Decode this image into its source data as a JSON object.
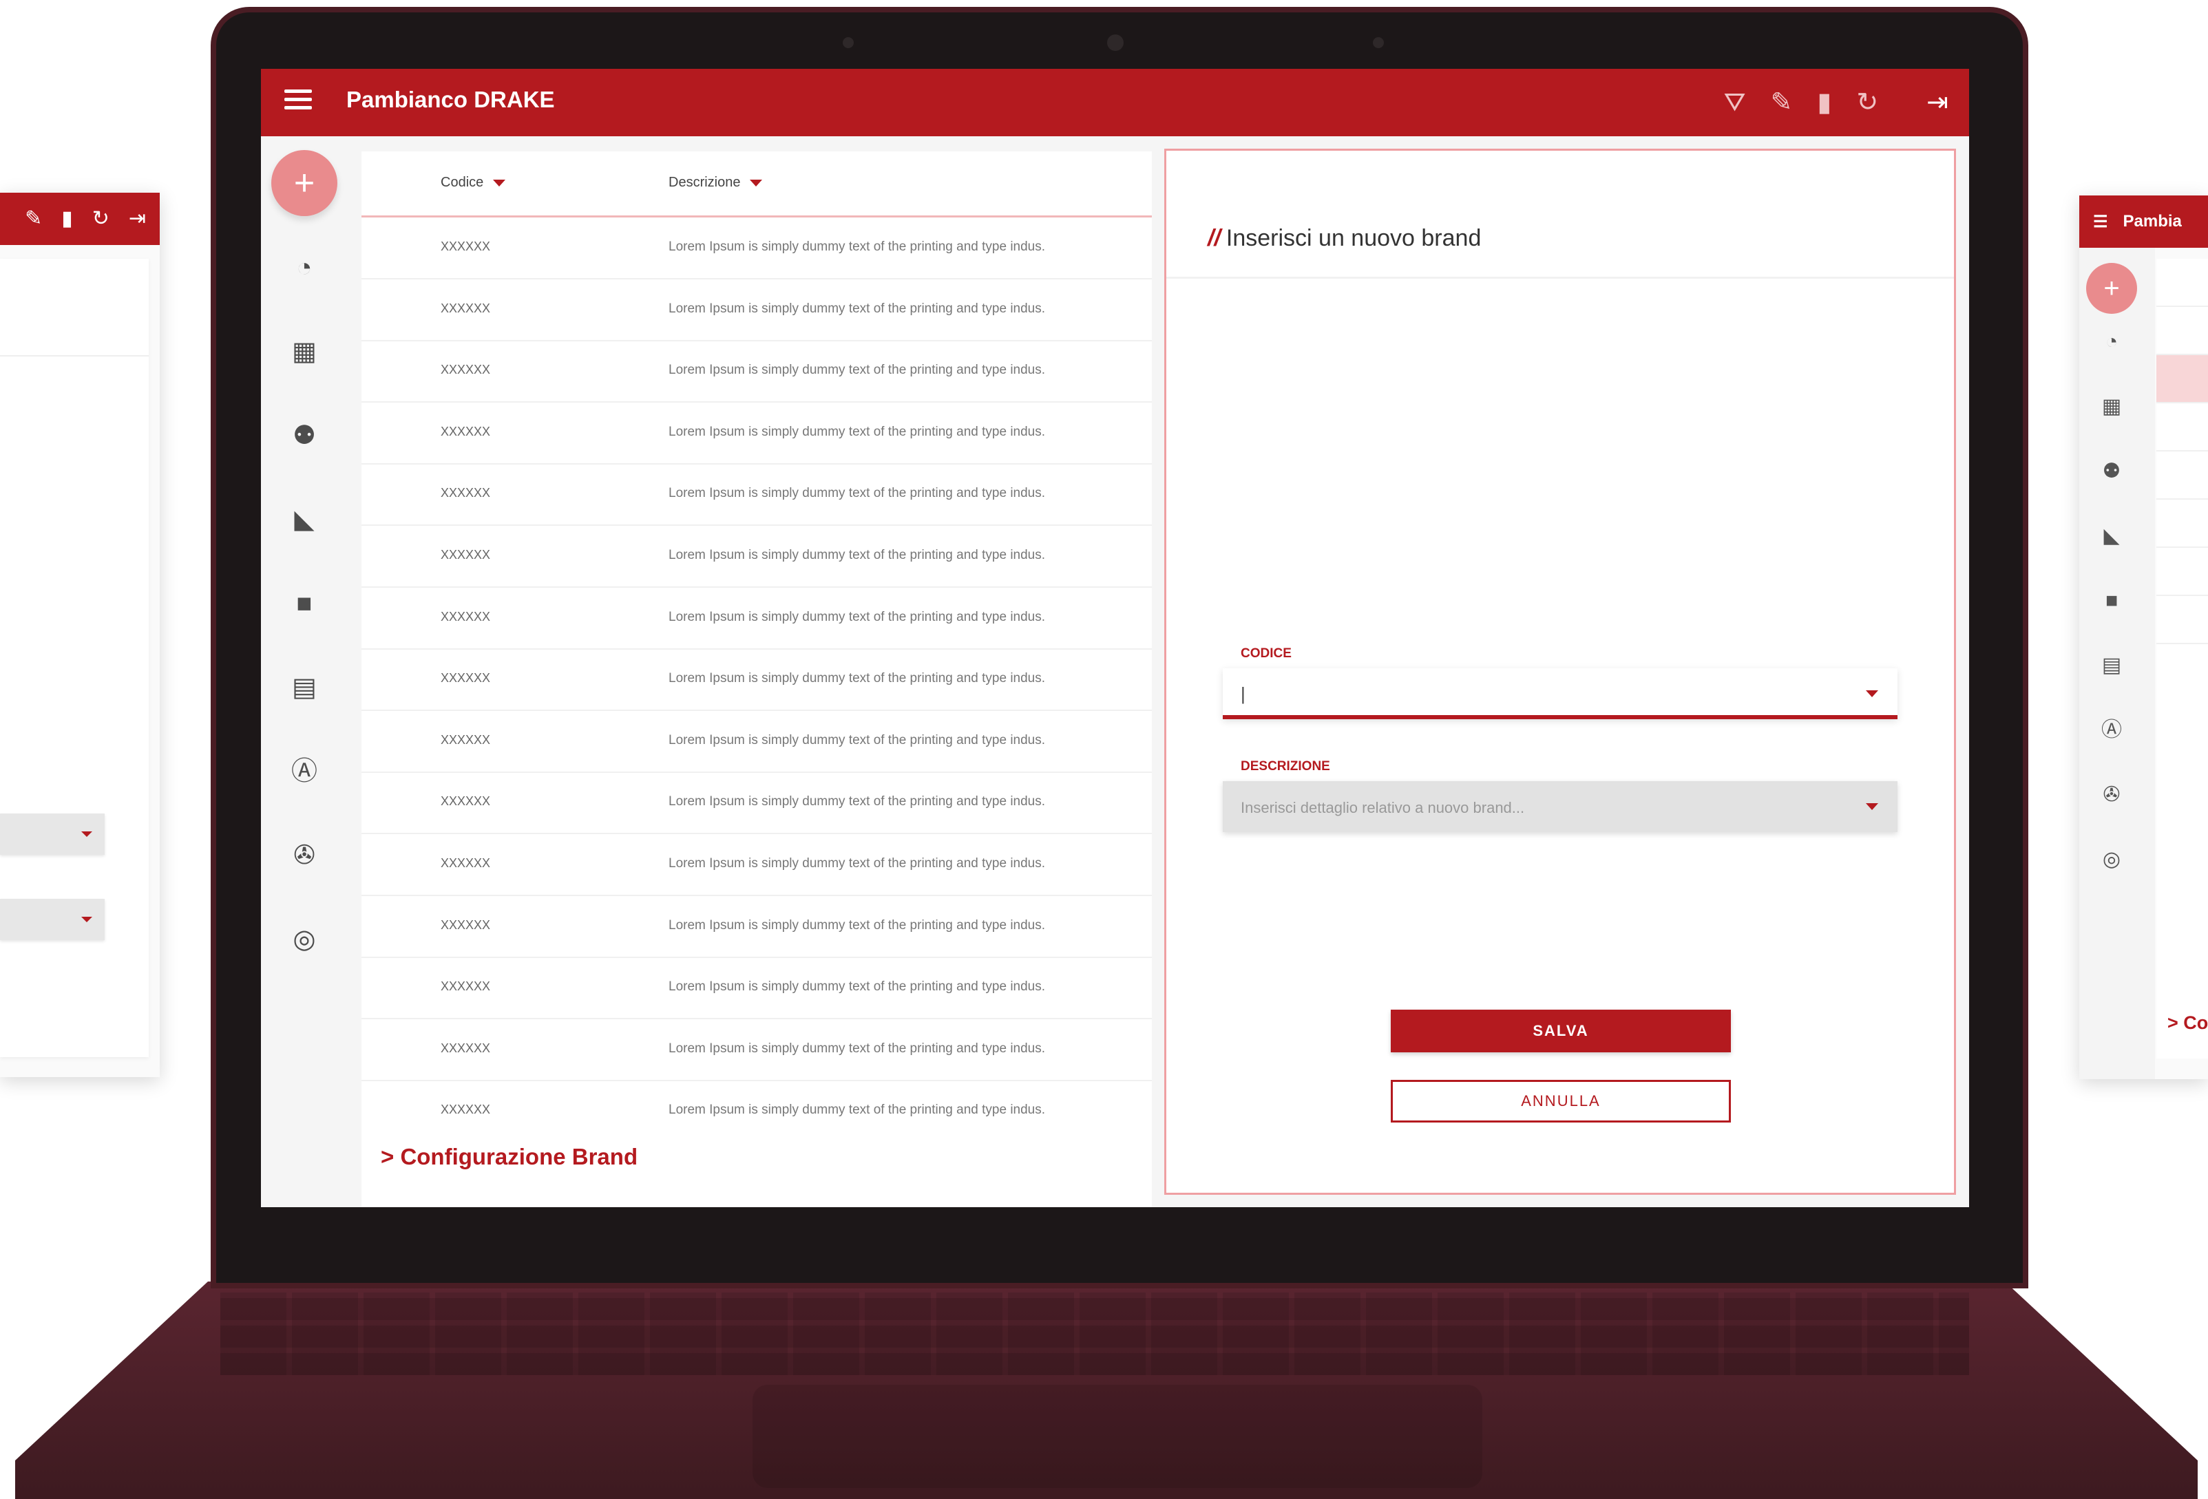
{
  "app": {
    "title": "Pambianco DRAKE"
  },
  "side_right": {
    "title_partial": "Pambia",
    "footer_partial": "> Co"
  },
  "toolbar": {
    "filter_icon": "filter-off-icon",
    "edit_icon": "pencil-icon",
    "delete_icon": "trash-icon",
    "refresh_icon": "refresh-icon",
    "logout_icon": "logout-icon"
  },
  "sidebar": {
    "add_label": "+",
    "items": [
      {
        "icon": "dashboard-icon"
      },
      {
        "icon": "buildings-icon"
      },
      {
        "icon": "people-group-icon"
      },
      {
        "icon": "fabric-swatches-icon"
      },
      {
        "icon": "truck-icon"
      },
      {
        "icon": "book-icon"
      },
      {
        "icon": "letter-a-icon"
      },
      {
        "icon": "film-reel-icon"
      },
      {
        "icon": "target-icon"
      }
    ]
  },
  "table": {
    "columns": [
      "Codice",
      "Descrizione"
    ],
    "rows": [
      {
        "code": "XXXXXX",
        "desc": "Lorem Ipsum is simply dummy text of the printing and type indus."
      },
      {
        "code": "XXXXXX",
        "desc": "Lorem Ipsum is simply dummy text of the printing and type indus."
      },
      {
        "code": "XXXXXX",
        "desc": "Lorem Ipsum is simply dummy text of the printing and type indus."
      },
      {
        "code": "XXXXXX",
        "desc": "Lorem Ipsum is simply dummy text of the printing and type indus."
      },
      {
        "code": "XXXXXX",
        "desc": "Lorem Ipsum is simply dummy text of the printing and type indus."
      },
      {
        "code": "XXXXXX",
        "desc": "Lorem Ipsum is simply dummy text of the printing and type indus."
      },
      {
        "code": "XXXXXX",
        "desc": "Lorem Ipsum is simply dummy text of the printing and type indus."
      },
      {
        "code": "XXXXXX",
        "desc": "Lorem Ipsum is simply dummy text of the printing and type indus."
      },
      {
        "code": "XXXXXX",
        "desc": "Lorem Ipsum is simply dummy text of the printing and type indus."
      },
      {
        "code": "XXXXXX",
        "desc": "Lorem Ipsum is simply dummy text of the printing and type indus."
      },
      {
        "code": "XXXXXX",
        "desc": "Lorem Ipsum is simply dummy text of the printing and type indus."
      },
      {
        "code": "XXXXXX",
        "desc": "Lorem Ipsum is simply dummy text of the printing and type indus."
      },
      {
        "code": "XXXXXX",
        "desc": "Lorem Ipsum is simply dummy text of the printing and type indus."
      },
      {
        "code": "XXXXXX",
        "desc": "Lorem Ipsum is simply dummy text of the printing and type indus."
      },
      {
        "code": "XXXXXX",
        "desc": "Lorem Ipsum is simply dummy text of the printing and type indus."
      }
    ],
    "footer": "> Configurazione Brand"
  },
  "form": {
    "title_prefix": "//",
    "title": "Inserisci un nuovo brand",
    "code_label": "CODICE",
    "code_value": "|",
    "desc_label": "DESCRIZIONE",
    "desc_placeholder": "Inserisci dettaglio relativo a nuovo brand...",
    "save_label": "SALVA",
    "cancel_label": "ANNULLA"
  },
  "colors": {
    "primary": "#b41a1f",
    "accent_light": "#e98b8d",
    "background": "#f5f5f5",
    "laptop_body": "#4a1d24"
  }
}
